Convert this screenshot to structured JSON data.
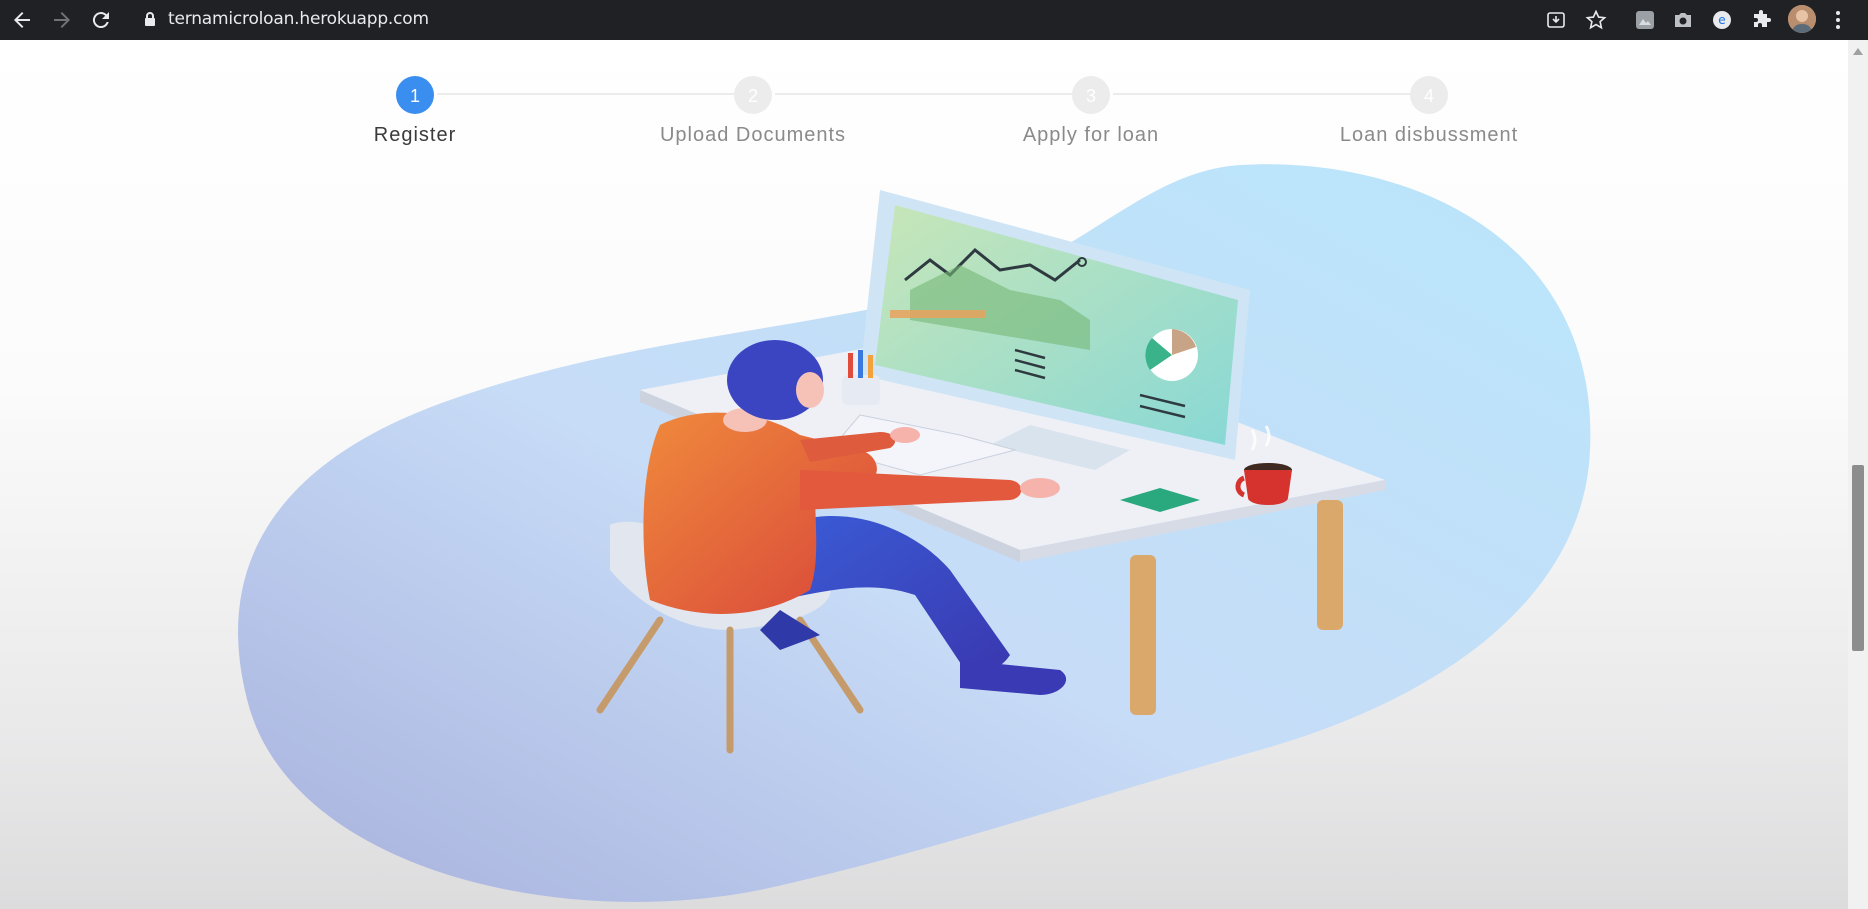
{
  "browser": {
    "url": "ternamicroloan.herokuapp.com"
  },
  "steps": [
    {
      "number": "1",
      "label": "Register",
      "active": true
    },
    {
      "number": "2",
      "label": "Upload Documents",
      "active": false
    },
    {
      "number": "3",
      "label": "Apply for loan",
      "active": false
    },
    {
      "number": "4",
      "label": "Loan disbussment",
      "active": false
    }
  ],
  "colors": {
    "accent": "#3a8ef0",
    "inactive_step": "#ececec"
  }
}
